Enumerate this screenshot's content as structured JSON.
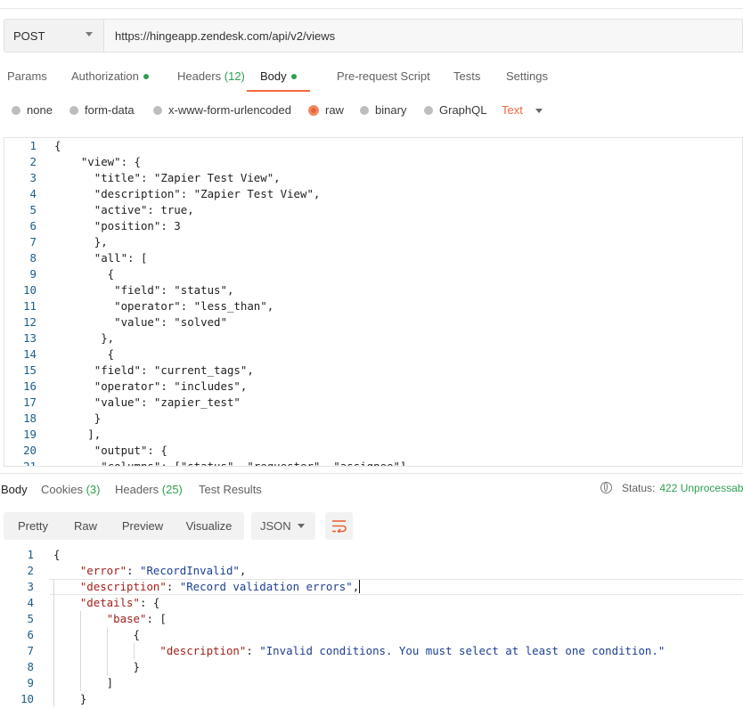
{
  "request": {
    "method": "POST",
    "url": "https://hingeapp.zendesk.com/api/v2/views"
  },
  "request_tabs": [
    {
      "label": "Params"
    },
    {
      "label": "Authorization",
      "dot": true
    },
    {
      "label": "Headers",
      "count": "(12)"
    },
    {
      "label": "Body",
      "dot": true,
      "active": true
    },
    {
      "label": "Pre-request Script"
    },
    {
      "label": "Tests"
    },
    {
      "label": "Settings"
    }
  ],
  "body_types": [
    {
      "label": "none"
    },
    {
      "label": "form-data"
    },
    {
      "label": "x-www-form-urlencoded"
    },
    {
      "label": "raw",
      "selected": true
    },
    {
      "label": "binary"
    },
    {
      "label": "GraphQL"
    }
  ],
  "raw_format": "Text",
  "request_body_lines": [
    {
      "n": "1",
      "text": "{"
    },
    {
      "n": "2",
      "text": "    \"view\": {"
    },
    {
      "n": "3",
      "text": "      \"title\": \"Zapier Test View\","
    },
    {
      "n": "4",
      "text": "      \"description\": \"Zapier Test View\","
    },
    {
      "n": "5",
      "text": "      \"active\": true,"
    },
    {
      "n": "6",
      "text": "      \"position\": 3"
    },
    {
      "n": "7",
      "text": "      },"
    },
    {
      "n": "8",
      "text": "      \"all\": ["
    },
    {
      "n": "9",
      "text": "        {"
    },
    {
      "n": "10",
      "text": "         \"field\": \"status\","
    },
    {
      "n": "11",
      "text": "         \"operator\": \"less_than\","
    },
    {
      "n": "12",
      "text": "         \"value\": \"solved\""
    },
    {
      "n": "13",
      "text": "       },"
    },
    {
      "n": "14",
      "text": "        {"
    },
    {
      "n": "15",
      "text": "      \"field\": \"current_tags\","
    },
    {
      "n": "16",
      "text": "      \"operator\": \"includes\","
    },
    {
      "n": "17",
      "text": "      \"value\": \"zapier_test\""
    },
    {
      "n": "18",
      "text": "      }"
    },
    {
      "n": "19",
      "text": "     ],"
    },
    {
      "n": "20",
      "text": "      \"output\": {"
    },
    {
      "n": "21",
      "text": "       \"columns\": [\"status\", \"requester\", \"assignee\"]"
    }
  ],
  "response_tabs": [
    {
      "label": "Body",
      "active": true
    },
    {
      "label": "Cookies",
      "count": "(3)"
    },
    {
      "label": "Headers",
      "count": "(25)"
    },
    {
      "label": "Test Results"
    }
  ],
  "status": {
    "label": "Status:",
    "value": "422 Unprocessab"
  },
  "view_modes": [
    "Pretty",
    "Raw",
    "Preview",
    "Visualize"
  ],
  "response_format": "JSON",
  "response_lines": [
    {
      "n": "1",
      "parts": [
        {
          "t": "{",
          "c": "p"
        }
      ]
    },
    {
      "n": "2",
      "parts": [
        {
          "t": "    ",
          "c": "p"
        },
        {
          "t": "\"error\"",
          "c": "key"
        },
        {
          "t": ": ",
          "c": "p"
        },
        {
          "t": "\"RecordInvalid\"",
          "c": "str"
        },
        {
          "t": ",",
          "c": "p"
        }
      ]
    },
    {
      "n": "3",
      "parts": [
        {
          "t": "    ",
          "c": "p"
        },
        {
          "t": "\"description\"",
          "c": "key"
        },
        {
          "t": ": ",
          "c": "p"
        },
        {
          "t": "\"Record validation errors\"",
          "c": "str"
        },
        {
          "t": ",",
          "c": "p"
        }
      ]
    },
    {
      "n": "4",
      "parts": [
        {
          "t": "    ",
          "c": "p"
        },
        {
          "t": "\"details\"",
          "c": "key"
        },
        {
          "t": ": {",
          "c": "p"
        }
      ]
    },
    {
      "n": "5",
      "parts": [
        {
          "t": "        ",
          "c": "p"
        },
        {
          "t": "\"base\"",
          "c": "key"
        },
        {
          "t": ": [",
          "c": "p"
        }
      ]
    },
    {
      "n": "6",
      "parts": [
        {
          "t": "            {",
          "c": "p"
        }
      ]
    },
    {
      "n": "7",
      "parts": [
        {
          "t": "                ",
          "c": "p"
        },
        {
          "t": "\"description\"",
          "c": "key"
        },
        {
          "t": ": ",
          "c": "p"
        },
        {
          "t": "\"Invalid conditions. You must select at least one condition.\"",
          "c": "str"
        }
      ]
    },
    {
      "n": "8",
      "parts": [
        {
          "t": "            }",
          "c": "p"
        }
      ]
    },
    {
      "n": "9",
      "parts": [
        {
          "t": "        ]",
          "c": "p"
        }
      ]
    },
    {
      "n": "10",
      "parts": [
        {
          "t": "    }",
          "c": "p"
        }
      ]
    }
  ],
  "colors": {
    "accent": "#f26b3a",
    "ok_dot": "#2e9e50",
    "json_key": "#a3201a",
    "json_string": "#1c3f93",
    "line_number": "#1a5e8a"
  }
}
